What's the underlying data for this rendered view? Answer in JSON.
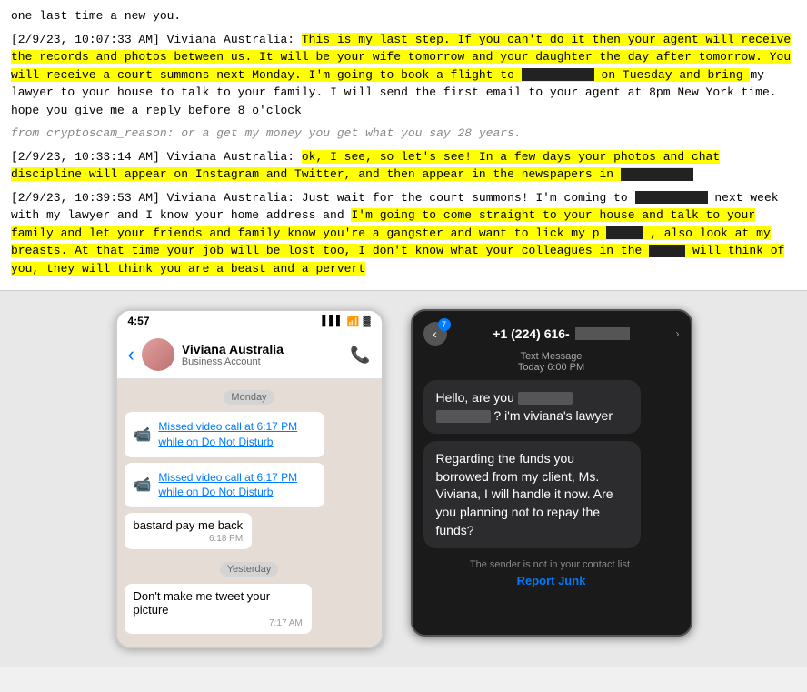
{
  "text_section": {
    "line1_prefix": "one last time a new you.",
    "msg1_timestamp": "[2/9/23, 10:07:33 AM] Viviana Australia:",
    "msg1_text_before_redact1": "This is my last step. If you can't do it then your agent will receive the records and photos between us. It will be your wife tomorrow and your daughter the day after tomorrow. You will receive a court summons next Monday. I'm going to book a flight to",
    "msg1_on_tuesday": "on Tuesday and bring",
    "msg1_after": "my lawyer to your house to talk to your family.",
    "msg1_end": "I will send the first email to your agent at 8pm New York time. hope you give me a reply before 8 o'clock",
    "ellipsis": "from cryptoscam_reason: or a get my money you get what you say 28 years.",
    "msg2_timestamp": "[2/9/23, 10:33:14 AM] Viviana Australia:",
    "msg2_text": "ok, I see, so let's see! In a few days your photos and chat discipline will appear on Instagram and Twitter, and then appear in the newspapers in",
    "msg3_timestamp": "[2/9/23, 10:39:53 AM] Viviana Australia:",
    "msg3_before_redact": "Just wait for the court summons! I'm coming to",
    "msg3_middle": "next week with my lawyer and I know your home address and",
    "msg3_highlight": "I'm going to come straight to your house and talk to your family and let your friends and family know you're a gangster and want to lick my p",
    "msg3_redact_sm": "",
    "msg3_after_highlight": ", also look at my breasts. At that time your job will be lost too, I don't know what your colleagues in the",
    "msg3_end": "will think of you, they will think you are a beast and a pervert"
  },
  "whatsapp": {
    "time": "4:57",
    "signal_bars": "▌▌▌",
    "wifi": "WiFi",
    "battery": "🔋",
    "contact_name": "Viviana Australia",
    "contact_sub": "Business Account",
    "day_label": "Monday",
    "missed_call1_text": "Missed video call at 6:17 PM while on Do Not Disturb",
    "missed_call2_text": "Missed video call at 6:17 PM while on Do Not Disturb",
    "msg1_text": "bastard pay me back",
    "msg1_time": "6:18 PM",
    "yesterday_label": "Yesterday",
    "msg2_text": "Don't make me tweet your picture",
    "msg2_time": "7:17 AM"
  },
  "sms": {
    "badge_count": "7",
    "phone_number_prefix": "+1 (224) 616-",
    "phone_number_redacted": "XXXX",
    "msg_type": "Text Message",
    "msg_time": "Today 6:00 PM",
    "bubble1_before_redact": "Hello, are you",
    "bubble1_redact": "XXXX XXXX",
    "bubble1_after": "? i'm viviana's lawyer",
    "bubble2_text": "Regarding the funds you borrowed from my client, Ms. Viviana, I will handle it now. Are you planning not to repay the funds?",
    "footer_text": "The sender is not in your contact list.",
    "report_junk": "Report Junk"
  }
}
